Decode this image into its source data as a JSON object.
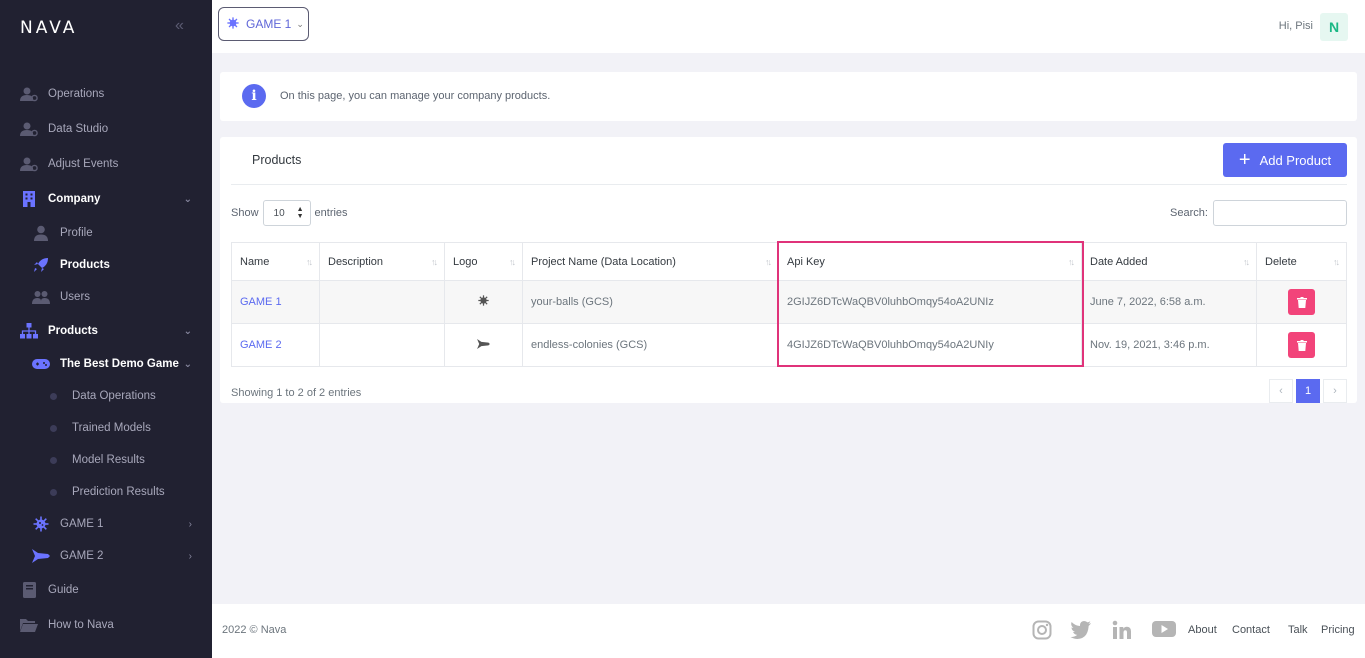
{
  "brand": {
    "name": "NAVA"
  },
  "sidebar": {
    "items": [
      {
        "label": "Operations"
      },
      {
        "label": "Data Studio"
      },
      {
        "label": "Adjust Events"
      },
      {
        "label": "Company"
      },
      {
        "label": "Profile"
      },
      {
        "label": "Products"
      },
      {
        "label": "Users"
      },
      {
        "label": "Products"
      },
      {
        "label": "The Best Demo Game"
      },
      {
        "label": "Data Operations"
      },
      {
        "label": "Trained Models"
      },
      {
        "label": "Model Results"
      },
      {
        "label": "Prediction Results"
      },
      {
        "label": "GAME 1"
      },
      {
        "label": "GAME 2"
      },
      {
        "label": "Guide"
      },
      {
        "label": "How to Nava"
      }
    ]
  },
  "topbar": {
    "game_selector": "GAME 1",
    "greeting": "Hi, Pisi",
    "avatar_initial": "N"
  },
  "info": {
    "text": "On this page, you can manage your company products."
  },
  "products": {
    "title": "Products",
    "add_label": "Add Product",
    "show_label": "Show",
    "entries_label": "entries",
    "page_size": "10",
    "search_label": "Search:",
    "columns": [
      "Name",
      "Description",
      "Logo",
      "Project Name (Data Location)",
      "Api Key",
      "Date Added",
      "Delete"
    ],
    "rows": [
      {
        "name": "GAME 1",
        "description": "",
        "project": "your-balls (GCS)",
        "api_key": "2GIJZ6DTcWaQBV0luhbOmqy54oA2UNIz",
        "date": "June 7, 2022, 6:58 a.m."
      },
      {
        "name": "GAME 2",
        "description": "",
        "project": "endless-colonies (GCS)",
        "api_key": "4GIJZ6DTcWaQBV0luhbOmqy54oA2UNIy",
        "date": "Nov. 19, 2021, 3:46 p.m."
      }
    ],
    "showing": "Showing 1 to 2 of 2 entries",
    "page": "1"
  },
  "footer": {
    "copyright": "2022 © Nava",
    "links": [
      "About",
      "Contact",
      "Talk",
      "Pricing"
    ]
  },
  "colors": {
    "accent": "#5b6af0",
    "danger": "#f2447a",
    "highlight": "#e0337a",
    "sidebar": "#212131"
  }
}
